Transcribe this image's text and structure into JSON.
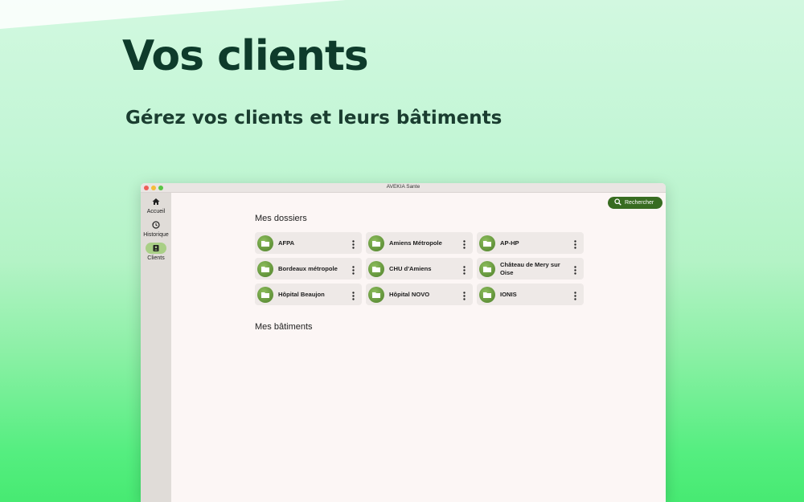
{
  "hero": {
    "title": "Vos clients",
    "subtitle": "Gérez vos clients et leurs bâtiments"
  },
  "window": {
    "title": "AVEKIA Sante"
  },
  "sidebar": {
    "items": [
      {
        "label": "Accueil",
        "icon": "home-icon",
        "active": false
      },
      {
        "label": "Historique",
        "icon": "history-icon",
        "active": false
      },
      {
        "label": "Clients",
        "icon": "contact-card-icon",
        "active": true
      }
    ]
  },
  "toolbar": {
    "search_label": "Rechercher"
  },
  "main": {
    "folders_heading": "Mes dossiers",
    "buildings_heading": "Mes bâtiments",
    "folders": [
      {
        "name": "AFPA"
      },
      {
        "name": "Amiens Métropole"
      },
      {
        "name": "AP-HP"
      },
      {
        "name": "Bordeaux métropole"
      },
      {
        "name": "CHU d'Amiens"
      },
      {
        "name": "Château de Mery sur Oise"
      },
      {
        "name": "Hôpital Beaujon"
      },
      {
        "name": "Hôpital NOVO"
      },
      {
        "name": "IONIS"
      }
    ]
  },
  "colors": {
    "accent": "#386c21",
    "active_nav": "#a9cf86",
    "headline": "#0e3b2b"
  }
}
